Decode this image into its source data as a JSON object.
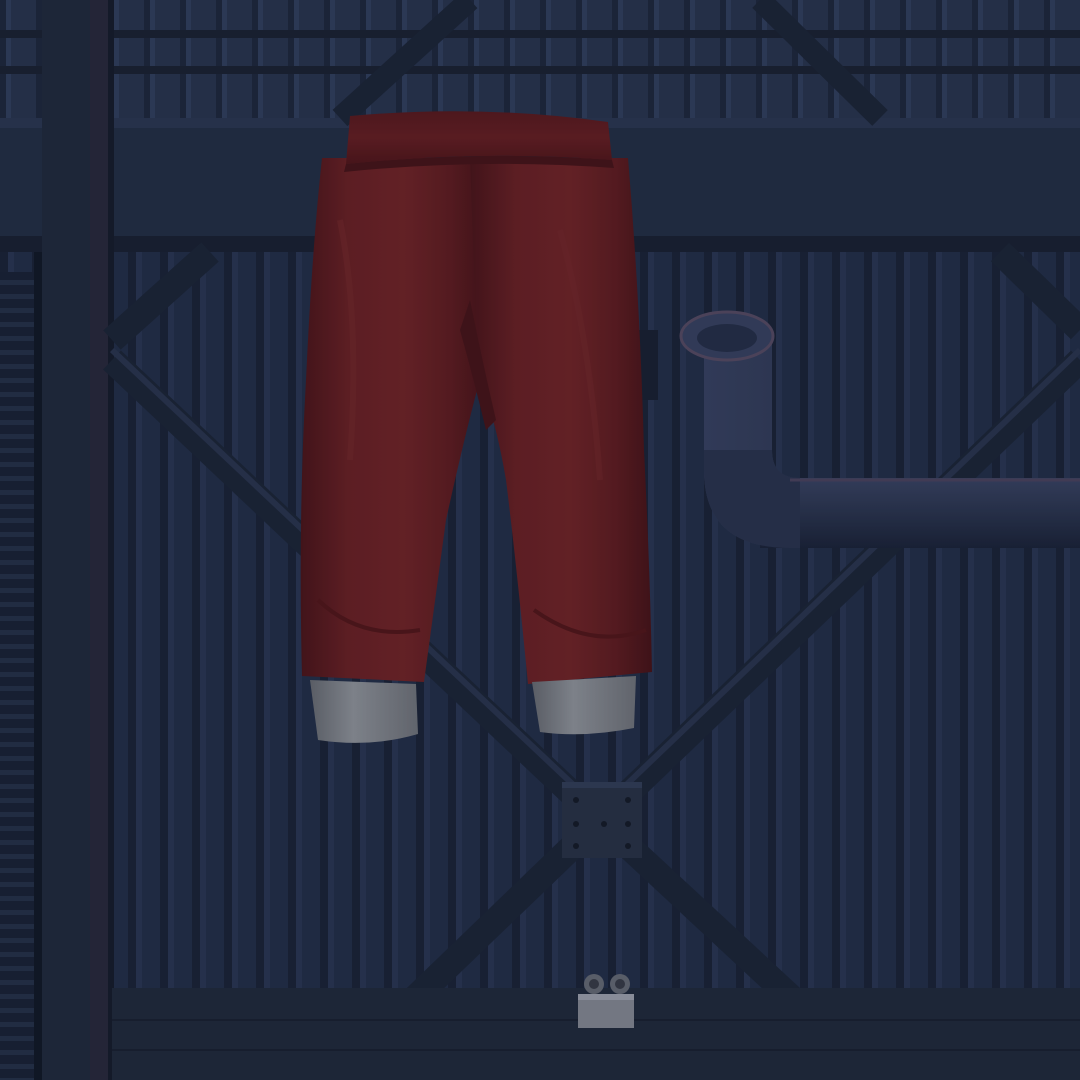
{
  "scene": {
    "kind": "clothing-preview",
    "item": "sweatpants",
    "colors": {
      "wall_dark": "#1e2838",
      "wall_mid": "#26324a",
      "wall_light": "#2d3a55",
      "beam": "#243046",
      "beam_shadow": "#161e2b",
      "pants": "#6a1f22",
      "pants_shadow": "#4a1418",
      "pants_light": "#7a2628",
      "cuff": "#8e9196",
      "cuff_shadow": "#6a6d73",
      "pipe": "#2c3650",
      "pipe_light": "#3d4866",
      "pipe_rim": "#5a4e66",
      "plate": "#2a3447",
      "floor": "#222b3c"
    }
  }
}
